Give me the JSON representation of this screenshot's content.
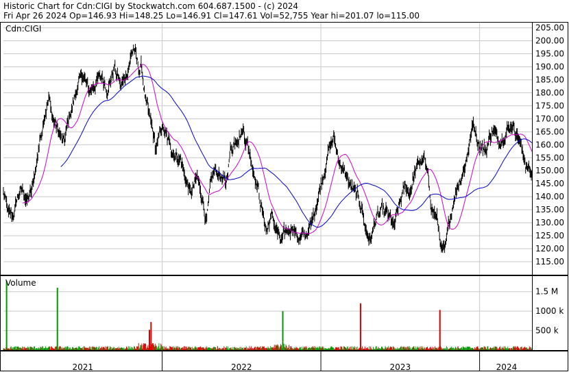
{
  "header": {
    "line1": "Historic Chart for Cdn:CIGI by Stockwatch.com 604.687.1500 - (c) 2024",
    "line2": "Fri Apr 26 2024   Op=146.93   Hi=148.25   Lo=146.91   Cl=147.61   Vol=52,755   Year hi=201.07   lo=115.00"
  },
  "chart_data": {
    "type": "line",
    "symbol_label": "Cdn:CIGI",
    "volume_label": "Volume",
    "price_axis": {
      "ylim": [
        110,
        207
      ],
      "ticks": [
        205,
        200,
        195,
        190,
        185,
        180,
        175,
        170,
        165,
        160,
        155,
        150,
        145,
        140,
        135,
        130,
        125,
        120,
        115
      ],
      "tick_labels": [
        "205.00",
        "200.00",
        "195.00",
        "190.00",
        "185.00",
        "180.00",
        "175.00",
        "170.00",
        "165.00",
        "160.00",
        "155.00",
        "150.00",
        "145.00",
        "140.00",
        "135.00",
        "130.00",
        "125.00",
        "120.00",
        "115.00"
      ]
    },
    "volume_axis": {
      "ylim": [
        0,
        1900000
      ],
      "ticks": [
        1500000,
        1000000,
        500000
      ],
      "tick_labels": [
        "1.5 M",
        "1000 k",
        "500 k"
      ]
    },
    "x_axis": {
      "range": [
        2021.0,
        2024.33
      ],
      "year_labels": [
        {
          "label": "2021",
          "center": 2021.5
        },
        {
          "label": "2022",
          "center": 2022.5
        },
        {
          "label": "2023",
          "center": 2023.5
        },
        {
          "label": "2024",
          "center": 2024.17
        }
      ],
      "year_boundaries": [
        2022.0,
        2023.0,
        2024.0
      ]
    },
    "grid": true,
    "price_keypoints": [
      [
        2021.0,
        142
      ],
      [
        2021.03,
        133
      ],
      [
        2021.06,
        132
      ],
      [
        2021.09,
        140
      ],
      [
        2021.12,
        143
      ],
      [
        2021.15,
        138
      ],
      [
        2021.18,
        142
      ],
      [
        2021.22,
        158
      ],
      [
        2021.26,
        173
      ],
      [
        2021.29,
        178
      ],
      [
        2021.31,
        170
      ],
      [
        2021.34,
        166
      ],
      [
        2021.38,
        160
      ],
      [
        2021.42,
        172
      ],
      [
        2021.46,
        181
      ],
      [
        2021.5,
        187
      ],
      [
        2021.54,
        180
      ],
      [
        2021.58,
        184
      ],
      [
        2021.62,
        186
      ],
      [
        2021.66,
        182
      ],
      [
        2021.7,
        190
      ],
      [
        2021.74,
        182
      ],
      [
        2021.78,
        188
      ],
      [
        2021.82,
        198
      ],
      [
        2021.85,
        189
      ],
      [
        2021.87,
        190
      ],
      [
        2021.9,
        175
      ],
      [
        2021.93,
        168
      ],
      [
        2021.96,
        158
      ],
      [
        2022.0,
        167
      ],
      [
        2022.03,
        162
      ],
      [
        2022.07,
        157
      ],
      [
        2022.12,
        154
      ],
      [
        2022.15,
        146
      ],
      [
        2022.18,
        141
      ],
      [
        2022.22,
        147
      ],
      [
        2022.26,
        138
      ],
      [
        2022.28,
        130
      ],
      [
        2022.31,
        146
      ],
      [
        2022.34,
        150
      ],
      [
        2022.37,
        148
      ],
      [
        2022.4,
        144
      ],
      [
        2022.43,
        158
      ],
      [
        2022.47,
        163
      ],
      [
        2022.51,
        166
      ],
      [
        2022.54,
        160
      ],
      [
        2022.57,
        152
      ],
      [
        2022.6,
        145
      ],
      [
        2022.63,
        134
      ],
      [
        2022.66,
        127
      ],
      [
        2022.69,
        133
      ],
      [
        2022.72,
        127
      ],
      [
        2022.75,
        122
      ],
      [
        2022.78,
        126
      ],
      [
        2022.82,
        129
      ],
      [
        2022.86,
        124
      ],
      [
        2022.9,
        125
      ],
      [
        2022.94,
        129
      ],
      [
        2022.98,
        140
      ],
      [
        2023.02,
        150
      ],
      [
        2023.05,
        158
      ],
      [
        2023.08,
        163
      ],
      [
        2023.11,
        155
      ],
      [
        2023.14,
        150
      ],
      [
        2023.18,
        145
      ],
      [
        2023.22,
        141
      ],
      [
        2023.26,
        136
      ],
      [
        2023.28,
        128
      ],
      [
        2023.31,
        123
      ],
      [
        2023.34,
        130
      ],
      [
        2023.38,
        134
      ],
      [
        2023.42,
        133
      ],
      [
        2023.46,
        128
      ],
      [
        2023.5,
        138
      ],
      [
        2023.53,
        144
      ],
      [
        2023.56,
        142
      ],
      [
        2023.59,
        149
      ],
      [
        2023.62,
        153
      ],
      [
        2023.65,
        155
      ],
      [
        2023.67,
        148
      ],
      [
        2023.7,
        136
      ],
      [
        2023.73,
        132
      ],
      [
        2023.76,
        120
      ],
      [
        2023.78,
        118
      ],
      [
        2023.81,
        130
      ],
      [
        2023.84,
        140
      ],
      [
        2023.87,
        146
      ],
      [
        2023.9,
        150
      ],
      [
        2023.93,
        159
      ],
      [
        2023.96,
        168
      ],
      [
        2024.0,
        160
      ],
      [
        2024.04,
        158
      ],
      [
        2024.08,
        166
      ],
      [
        2024.12,
        162
      ],
      [
        2024.16,
        165
      ],
      [
        2024.2,
        168
      ],
      [
        2024.24,
        164
      ],
      [
        2024.27,
        157
      ],
      [
        2024.3,
        151
      ],
      [
        2024.33,
        148
      ]
    ],
    "series": [
      {
        "style": "ohlc-bars",
        "color": "#000000"
      },
      {
        "style": "moving-average-short",
        "color": "#cc00cc"
      },
      {
        "style": "moving-average-long",
        "color": "#0000cc"
      }
    ],
    "volume": {
      "base_level": 60000,
      "up_color": "#009900",
      "down_color": "#dd0000",
      "spikes": [
        {
          "x": 2021.02,
          "value": 1780000,
          "up": true
        },
        {
          "x": 2021.34,
          "value": 1600000,
          "up": true
        },
        {
          "x": 2021.93,
          "value": 720000,
          "up": false
        },
        {
          "x": 2021.92,
          "value": 520000,
          "up": false
        },
        {
          "x": 2022.76,
          "value": 1000000,
          "up": true
        },
        {
          "x": 2023.25,
          "value": 1200000,
          "up": false
        },
        {
          "x": 2023.75,
          "value": 1030000,
          "up": false
        }
      ]
    }
  },
  "colors": {
    "background": "#ffffff",
    "grid": "#c8c8c8",
    "frame": "#000000",
    "price": "#000000",
    "ma_short": "#cc00cc",
    "ma_long": "#0000cc",
    "volume_up": "#009900",
    "volume_down": "#dd0000"
  }
}
